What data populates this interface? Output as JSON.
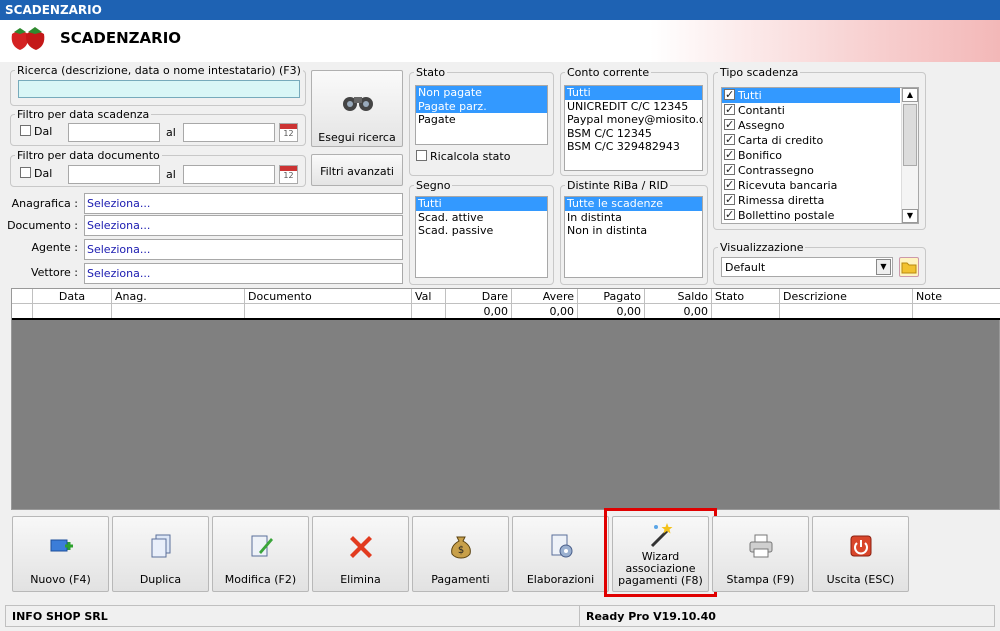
{
  "window": {
    "title": "SCADENZARIO"
  },
  "header": {
    "title": "SCADENZARIO"
  },
  "search": {
    "legend": "Ricerca (descrizione, data o nome intestatario) (F3)",
    "value": "",
    "button": "Esegui ricerca"
  },
  "filter_scadenza": {
    "legend": "Filtro per data scadenza",
    "dal": "Dal",
    "al": "al"
  },
  "filter_documento": {
    "legend": "Filtro per data documento",
    "dal": "Dal",
    "al": "al"
  },
  "advanced_button": "Filtri avanzati",
  "fields": [
    {
      "label": "Anagrafica :",
      "value": "Seleziona..."
    },
    {
      "label": "Documento :",
      "value": "Seleziona..."
    },
    {
      "label": "Agente :",
      "value": "Seleziona..."
    },
    {
      "label": "Vettore :",
      "value": "Seleziona..."
    }
  ],
  "stato": {
    "legend": "Stato",
    "items": [
      "Non pagate",
      "Pagate parz.",
      "Pagate"
    ],
    "ricalcola": "Ricalcola stato"
  },
  "conto": {
    "legend": "Conto corrente",
    "items": [
      "Tutti",
      "UNICREDIT C/C 12345",
      "Paypal money@miosito.com",
      "BSM C/C 12345",
      "BSM C/C 329482943"
    ]
  },
  "segno": {
    "legend": "Segno",
    "items": [
      "Tutti",
      "Scad. attive",
      "Scad. passive"
    ]
  },
  "distinte": {
    "legend": "Distinte RiBa / RID",
    "items": [
      "Tutte le scadenze",
      "In distinta",
      "Non in distinta"
    ]
  },
  "tipo": {
    "legend": "Tipo scadenza",
    "items": [
      "Tutti",
      "Contanti",
      "Assegno",
      "Carta di credito",
      "Bonifico",
      "Contrassegno",
      "Ricevuta bancaria",
      "Rimessa diretta",
      "Bollettino postale"
    ]
  },
  "visualizzazione": {
    "legend": "Visualizzazione",
    "value": "Default"
  },
  "grid": {
    "columns": [
      "Data",
      "Anag.",
      "Documento",
      "Val",
      "Dare",
      "Avere",
      "Pagato",
      "Saldo",
      "Stato",
      "Descrizione",
      "Note"
    ],
    "totals": {
      "dare": "0,00",
      "avere": "0,00",
      "pagato": "0,00",
      "saldo": "0,00"
    }
  },
  "buttons": {
    "nuovo": "Nuovo (F4)",
    "duplica": "Duplica",
    "modifica": "Modifica (F2)",
    "elimina": "Elimina",
    "pagamenti": "Pagamenti",
    "elaborazioni": "Elaborazioni",
    "wizard": [
      "Wizard",
      "associazione",
      "pagamenti (F8)"
    ],
    "stampa": "Stampa (F9)",
    "uscita": "Uscita (ESC)"
  },
  "status": {
    "company": "INFO SHOP SRL",
    "version": "Ready Pro V19.10.40"
  },
  "colors": {
    "selection": "#3399ff",
    "titlebar": "#1e62b3",
    "highlight": "#e00000"
  }
}
